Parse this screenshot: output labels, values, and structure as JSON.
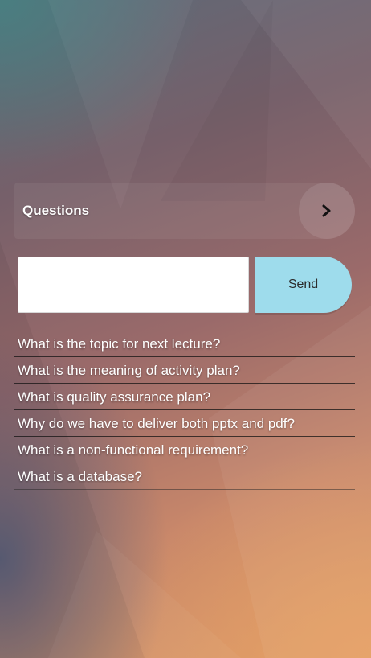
{
  "questions_panel": {
    "title": "Questions",
    "arrow_icon": "chevron-right-icon"
  },
  "composer": {
    "input_value": "",
    "input_placeholder": "",
    "send_label": "Send",
    "send_color": "#9edcec"
  },
  "questions": [
    "What is the topic for next lecture?",
    "What is the meaning of activity plan?",
    "What is quality assurance plan?",
    "Why do we have to deliver both pptx and pdf?",
    "What is a non-functional requirement?",
    "What is a database?"
  ]
}
